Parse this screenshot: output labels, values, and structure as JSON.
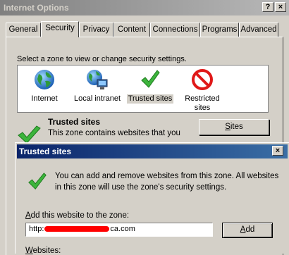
{
  "window": {
    "title": "Internet Options",
    "help_glyph": "?",
    "close_glyph": "×"
  },
  "tabs": [
    {
      "label": "General"
    },
    {
      "label": "Security"
    },
    {
      "label": "Privacy"
    },
    {
      "label": "Content"
    },
    {
      "label": "Connections"
    },
    {
      "label": "Programs"
    },
    {
      "label": "Advanced"
    }
  ],
  "active_tab": "Security",
  "security": {
    "zone_prompt": "Select a zone to view or change security settings.",
    "zones": [
      {
        "label": "Internet",
        "icon": "globe-icon"
      },
      {
        "label": "Local intranet",
        "icon": "local-intranet-icon"
      },
      {
        "label": "Trusted sites",
        "icon": "checkmark-icon"
      },
      {
        "label": "Restricted",
        "label2": "sites",
        "icon": "restricted-icon"
      }
    ],
    "selected_zone": "Trusted sites",
    "zone_heading": "Trusted sites",
    "zone_description": "This zone contains websites that you",
    "sites_button": {
      "prefix": "",
      "mnemonic": "S",
      "rest": "ites"
    }
  },
  "dialog": {
    "title": "Trusted sites",
    "close_glyph": "×",
    "message": "You can add and remove websites from this zone. All websites in this zone will use the zone's security settings.",
    "add_label": {
      "mnemonic": "A",
      "rest": "dd this website to the zone:"
    },
    "url_prefix": "http:",
    "url_suffix": "ca.com",
    "add_button": {
      "mnemonic": "A",
      "rest": "dd"
    },
    "websites_label": {
      "mnemonic": "W",
      "rest": "ebsites:"
    }
  },
  "colors": {
    "dialog_titlebar": "#0a246a",
    "check_green": "#3cb43c",
    "restricted_red": "#e01818",
    "redaction": "#ff0000"
  }
}
